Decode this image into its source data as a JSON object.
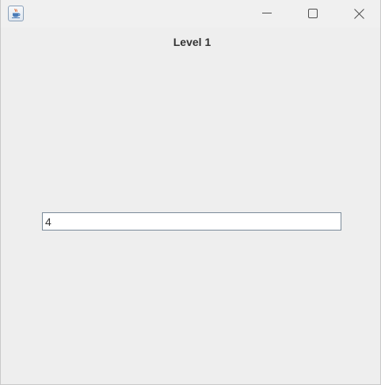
{
  "window": {
    "app_icon": "java-coffee-cup-icon",
    "controls": {
      "minimize_icon": "minimize-icon",
      "maximize_icon": "maximize-icon",
      "close_icon": "close-icon"
    }
  },
  "main": {
    "level_label": "Level 1",
    "answer_field": {
      "value": "4"
    }
  }
}
